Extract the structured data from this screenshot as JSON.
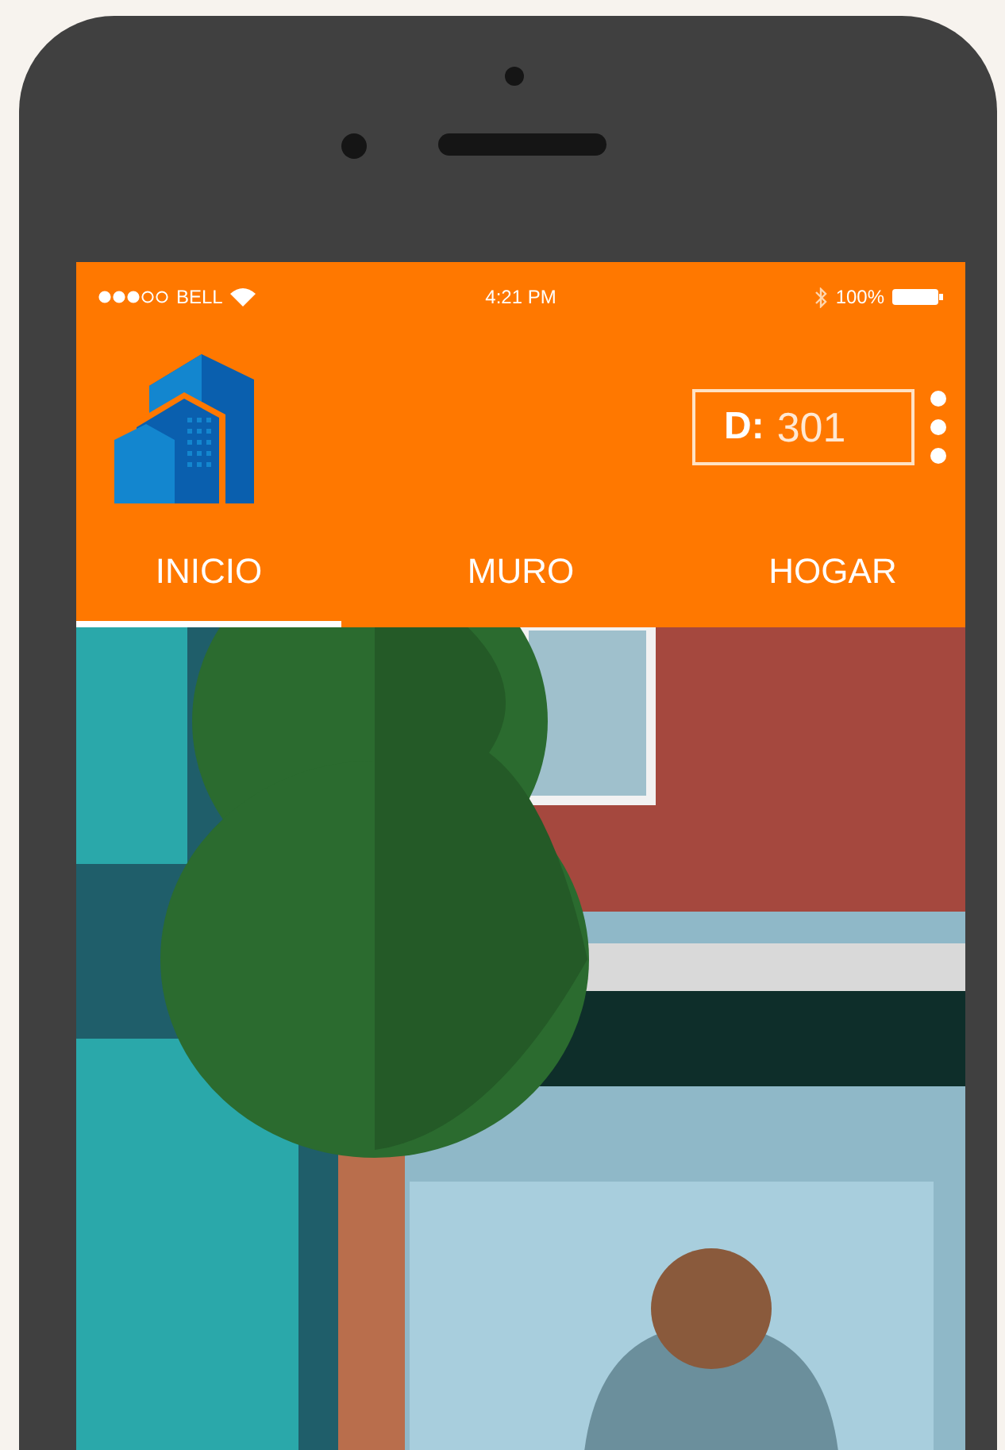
{
  "status_bar": {
    "carrier": "BELL",
    "time": "4:21 PM",
    "battery": "100%"
  },
  "counter": {
    "label": "D:",
    "value": "301"
  },
  "tabs": [
    {
      "label": "INICIO",
      "selected": true
    },
    {
      "label": "MURO",
      "selected": false
    },
    {
      "label": "HOGAR",
      "selected": false
    }
  ]
}
